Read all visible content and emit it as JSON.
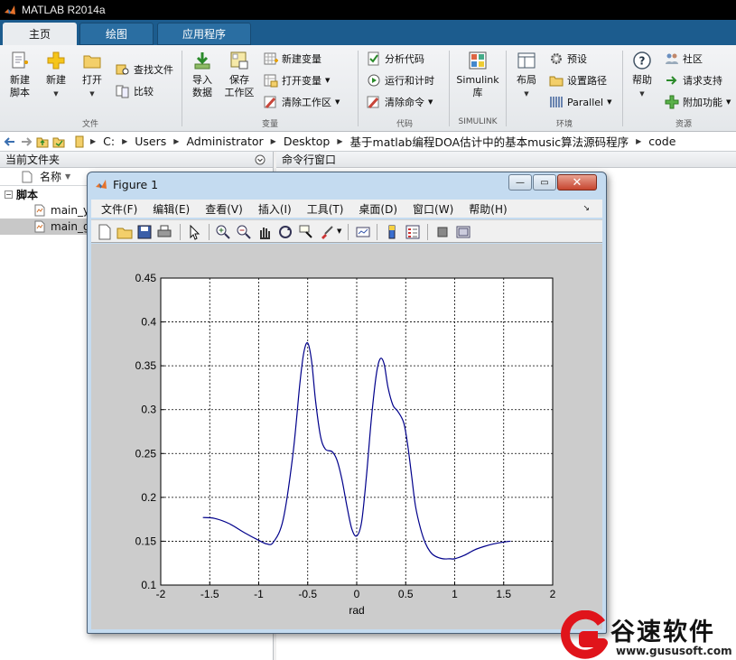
{
  "app": {
    "title": "MATLAB R2014a"
  },
  "tabs": [
    {
      "label": "主页"
    },
    {
      "label": "绘图"
    },
    {
      "label": "应用程序"
    }
  ],
  "ribbon": {
    "groups": {
      "file": "文件",
      "variable": "变量",
      "code": "代码",
      "simulink": "SIMULINK",
      "env": "环境",
      "resources": "资源"
    },
    "new_script": [
      "新建",
      "脚本"
    ],
    "new": "新建",
    "open": "打开",
    "find_files": "查找文件",
    "compare": "比较",
    "import": [
      "导入",
      "数据"
    ],
    "save_ws": [
      "保存",
      "工作区"
    ],
    "new_var": "新建变量",
    "open_var": "打开变量",
    "clear_ws": "清除工作区",
    "analyze": "分析代码",
    "run_time": "运行和计时",
    "clear_cmd": "清除命令",
    "simulink": [
      "Simulink",
      "库"
    ],
    "layout": "布局",
    "prefs": "预设",
    "set_path": "设置路径",
    "parallel": "Parallel",
    "help": "帮助",
    "community": "社区",
    "request_support": "请求支持",
    "addons": "附加功能"
  },
  "address": {
    "crumbs": [
      "C:",
      "Users",
      "Administrator",
      "Desktop",
      "基于matlab编程DOA估计中的基本music算法源码程序",
      "code"
    ]
  },
  "current_folder": {
    "title": "当前文件夹",
    "name_col": "名称",
    "group": "脚本",
    "files": [
      "main_y",
      "main_g"
    ]
  },
  "command_window": {
    "title": "命令行窗口"
  },
  "figure": {
    "title": "Figure 1",
    "menu": [
      "文件(F)",
      "编辑(E)",
      "查看(V)",
      "插入(I)",
      "工具(T)",
      "桌面(D)",
      "窗口(W)",
      "帮助(H)"
    ]
  },
  "chart_data": {
    "type": "line",
    "title": "",
    "xlabel": "rad",
    "ylabel": "",
    "xlim": [
      -2,
      2
    ],
    "ylim": [
      0.1,
      0.45
    ],
    "grid": true,
    "x_ticks": [
      "-2",
      "-1.5",
      "-1",
      "-0.5",
      "0",
      "0.5",
      "1",
      "1.5",
      "2"
    ],
    "y_ticks": [
      "0.1",
      "0.15",
      "0.2",
      "0.25",
      "0.3",
      "0.35",
      "0.4",
      "0.45"
    ],
    "series": [
      {
        "color": "#00008b",
        "x": [
          -1.57,
          -1.45,
          -1.3,
          -1.15,
          -1.0,
          -0.92,
          -0.85,
          -0.75,
          -0.65,
          -0.58,
          -0.54,
          -0.5,
          -0.46,
          -0.42,
          -0.37,
          -0.32,
          -0.25,
          -0.2,
          -0.15,
          -0.1,
          -0.05,
          0.0,
          0.05,
          0.1,
          0.15,
          0.2,
          0.24,
          0.28,
          0.32,
          0.37,
          0.42,
          0.48,
          0.52,
          0.56,
          0.6,
          0.65,
          0.7,
          0.75,
          0.8,
          0.88,
          0.95,
          1.0,
          1.1,
          1.2,
          1.3,
          1.4,
          1.5,
          1.57
        ],
        "y": [
          0.177,
          0.176,
          0.17,
          0.16,
          0.151,
          0.147,
          0.149,
          0.175,
          0.25,
          0.33,
          0.365,
          0.376,
          0.355,
          0.31,
          0.27,
          0.255,
          0.252,
          0.242,
          0.22,
          0.19,
          0.164,
          0.156,
          0.172,
          0.225,
          0.29,
          0.34,
          0.358,
          0.352,
          0.325,
          0.305,
          0.298,
          0.285,
          0.26,
          0.225,
          0.19,
          0.165,
          0.148,
          0.138,
          0.133,
          0.13,
          0.13,
          0.13,
          0.134,
          0.14,
          0.144,
          0.147,
          0.149,
          0.15
        ]
      }
    ]
  },
  "watermark": {
    "name": "谷速软件",
    "url": "www.gususoft.com"
  }
}
